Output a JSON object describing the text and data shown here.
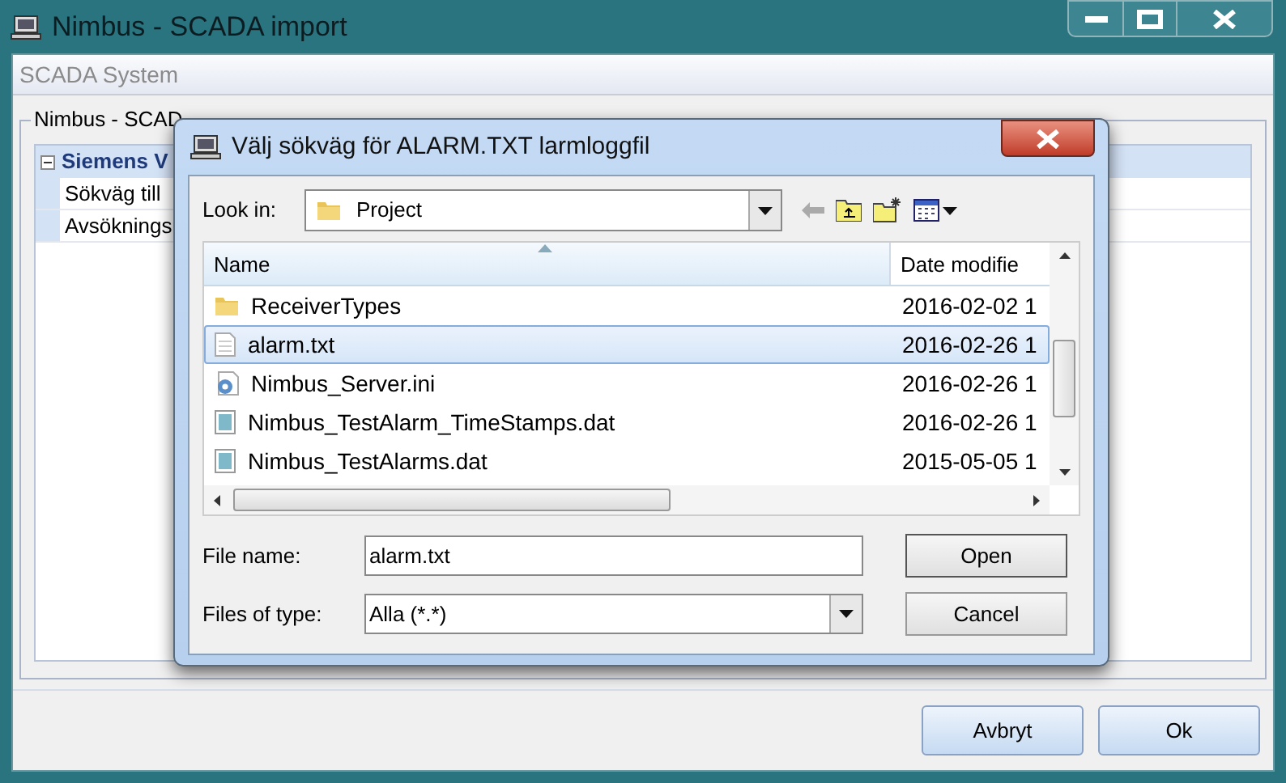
{
  "window": {
    "title": "Nimbus - SCADA import"
  },
  "section_header": "SCADA System",
  "group": {
    "legend": "Nimbus - SCAD"
  },
  "property_grid": {
    "category": {
      "label": "Siemens V",
      "expanded": true
    },
    "rows": [
      "Sökväg till",
      "Avsöknings"
    ]
  },
  "buttons": [
    "Avbryt",
    "Ok"
  ],
  "dialog": {
    "title": "Välj sökväg för ALARM.TXT larmloggfil",
    "look_in": {
      "label": "Look in:",
      "value": "Project"
    },
    "columns": [
      "Name",
      "Date modifie"
    ],
    "files": [
      {
        "kind": "folder",
        "name": "ReceiverTypes",
        "date": "2016-02-02 1",
        "selected": false
      },
      {
        "kind": "text",
        "name": "alarm.txt",
        "date": "2016-02-26 1",
        "selected": true
      },
      {
        "kind": "settings",
        "name": "Nimbus_Server.ini",
        "date": "2016-02-26 1",
        "selected": false
      },
      {
        "kind": "data",
        "name": "Nimbus_TestAlarm_TimeStamps.dat",
        "date": "2016-02-26 1",
        "selected": false
      },
      {
        "kind": "data",
        "name": "Nimbus_TestAlarms.dat",
        "date": "2015-05-05 1",
        "selected": false
      }
    ],
    "file_name": {
      "label": "File name:",
      "value": "alarm.txt"
    },
    "file_type": {
      "label": "Files of type:",
      "value": "Alla (*.*)"
    },
    "buttons": [
      "Open",
      "Cancel"
    ]
  }
}
